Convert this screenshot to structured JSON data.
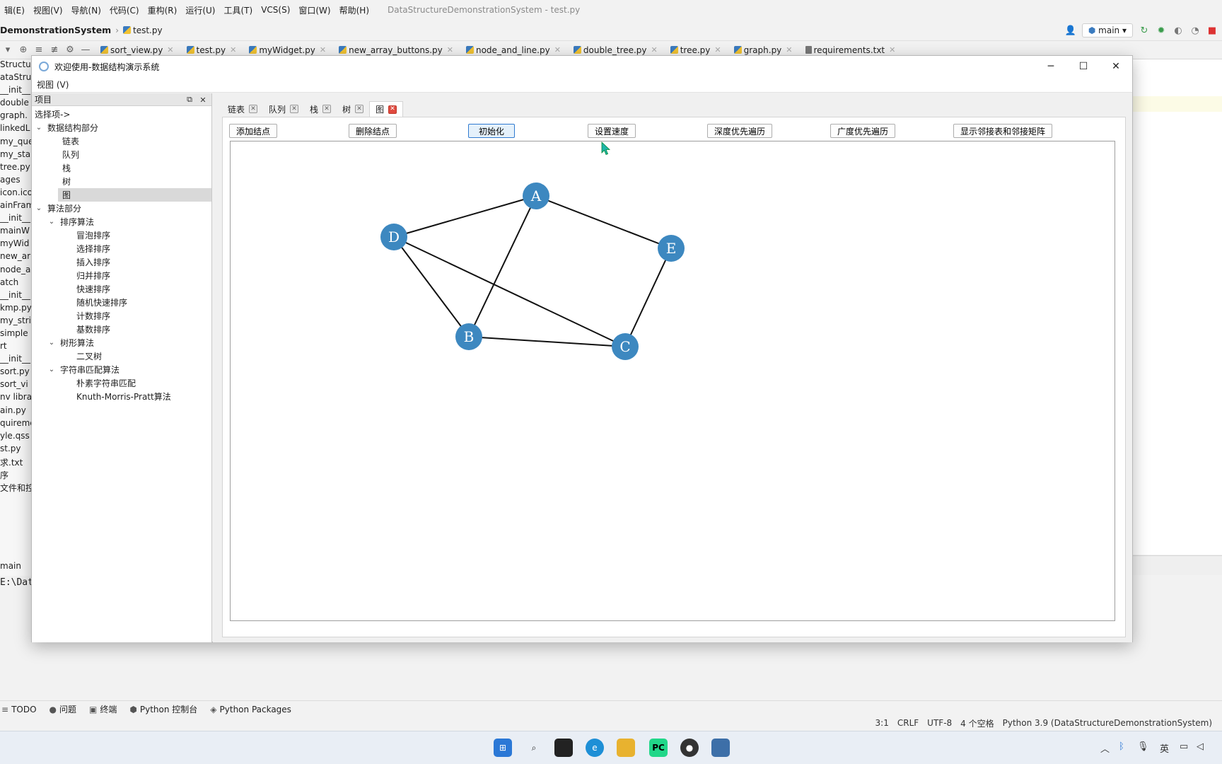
{
  "ide": {
    "menus": [
      "辑(E)",
      "视图(V)",
      "导航(N)",
      "代码(C)",
      "重构(R)",
      "运行(U)",
      "工具(T)",
      "VCS(S)",
      "窗口(W)",
      "帮助(H)"
    ],
    "window_title": "DataStructureDemonstrationSystem - test.py",
    "project_name": "DemonstrationSystem",
    "breadcrumb_file": "test.py",
    "branch": "main",
    "file_tabs": [
      "sort_view.py",
      "test.py",
      "myWidget.py",
      "new_array_buttons.py",
      "node_and_line.py",
      "double_tree.py",
      "tree.py",
      "graph.py",
      "requirements.txt"
    ],
    "project_items": [
      "Structu",
      "ataStruc",
      "__init__",
      "double",
      "graph.",
      "linkedL",
      "my_que",
      "my_sta",
      "tree.py",
      "ages",
      "icon.ico",
      "ainFram",
      "__init__",
      "mainW",
      "myWid",
      "new_ar",
      "node_a",
      "atch",
      "__init__",
      "kmp.py",
      "my_stri",
      "simple",
      "rt",
      "__init__",
      "sort.py",
      "sort_vi",
      "nv  libra",
      "ain.py",
      "quireme",
      "yle.qss",
      "st.py",
      "求.txt",
      "序",
      "文件和控"
    ],
    "run_tab": "main",
    "run_path": "E:\\Dat",
    "bottom_tools": [
      "TODO",
      "问题",
      "终端",
      "Python 控制台",
      "Python Packages"
    ],
    "status": {
      "position": "3:1",
      "line_sep": "CRLF",
      "encoding": "UTF-8",
      "indent": "4 个空格",
      "interpreter": "Python 3.9 (DataStructureDemonstrationSystem)"
    },
    "taskbar_lang": "英"
  },
  "app": {
    "title": "欢迎使用-数据结构演示系统",
    "menu_view": "视图 (V)",
    "dock_title": "项目",
    "tree": {
      "root_label": "选择项->",
      "ds_section": "数据结构部分",
      "ds_items": [
        "链表",
        "队列",
        "栈",
        "树",
        "图"
      ],
      "algo_section": "算法部分",
      "sort_group": "排序算法",
      "sort_items": [
        "冒泡排序",
        "选择排序",
        "插入排序",
        "归并排序",
        "快速排序",
        "随机快速排序",
        "计数排序",
        "基数排序"
      ],
      "tree_group": "树形算法",
      "tree_items": [
        "二叉树"
      ],
      "string_group": "字符串匹配算法",
      "string_items": [
        "朴素字符串匹配",
        "Knuth-Morris-Pratt算法"
      ]
    },
    "tabs": [
      "链表",
      "队列",
      "栈",
      "树",
      "图"
    ],
    "active_tab": "图",
    "buttons": {
      "add_node": "添加结点",
      "delete_node": "删除结点",
      "init": "初始化",
      "set_speed": "设置速度",
      "dfs": "深度优先遍历",
      "bfs": "广度优先遍历",
      "show_adjacency": "显示邻接表和邻接矩阵"
    },
    "graph": {
      "node_color": "#3d88c0",
      "nodes": [
        "A",
        "B",
        "C",
        "D",
        "E"
      ],
      "edges": [
        [
          "D",
          "A"
        ],
        [
          "A",
          "E"
        ],
        [
          "A",
          "B"
        ],
        [
          "D",
          "B"
        ],
        [
          "D",
          "C"
        ],
        [
          "B",
          "C"
        ],
        [
          "E",
          "C"
        ]
      ]
    }
  }
}
